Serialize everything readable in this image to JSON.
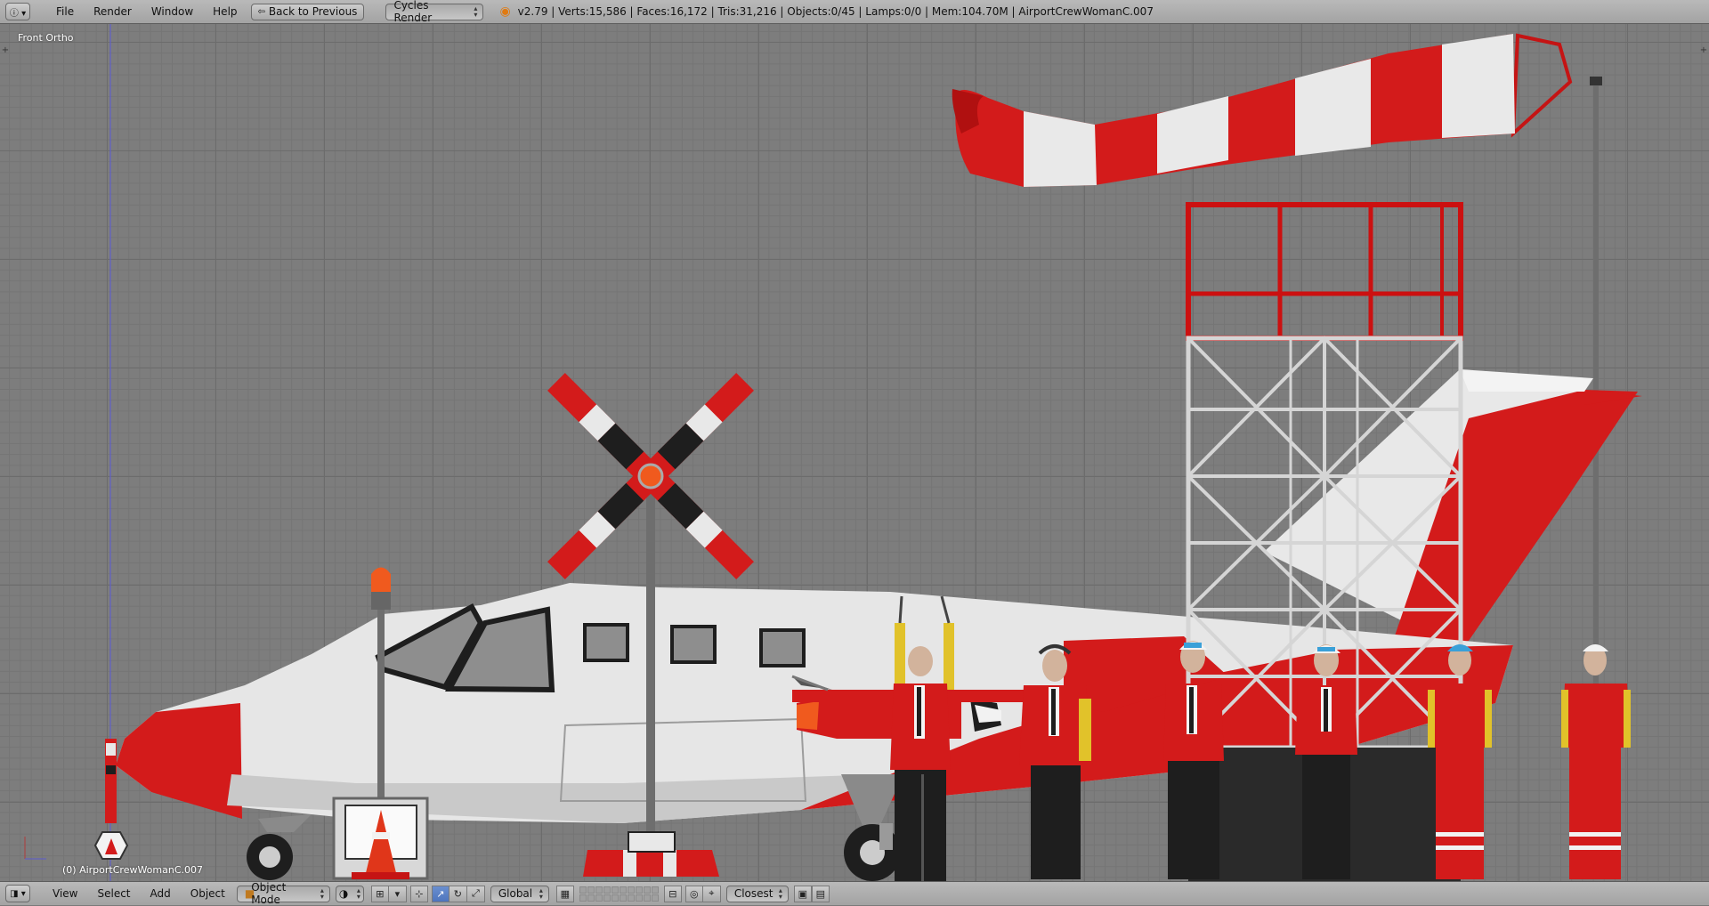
{
  "top_header": {
    "editor_icon": "info-icon",
    "menus": [
      "File",
      "Render",
      "Window",
      "Help"
    ],
    "back_button": "Back to Previous",
    "render_engine": "Cycles Render",
    "stats": "v2.79 | Verts:15,586 | Faces:16,172 | Tris:31,216 | Objects:0/45 | Lamps:0/0 | Mem:104.70M | AirportCrewWomanC.007"
  },
  "viewport": {
    "view_name": "Front Ortho",
    "active_object": "(0) AirportCrewWomanC.007",
    "grid_color": "#6c6c6c",
    "background_color": "#7d7d7d"
  },
  "bottom_header": {
    "editor_icon": "3d-view-icon",
    "menus": [
      "View",
      "Select",
      "Add",
      "Object"
    ],
    "mode": "Object Mode",
    "transform_orientation": "Global",
    "snap_target": "Closest"
  },
  "colors": {
    "red": "#d41616",
    "white": "#e6e6e6",
    "dark_red": "#a80d0d",
    "black": "#1e1e1e"
  }
}
